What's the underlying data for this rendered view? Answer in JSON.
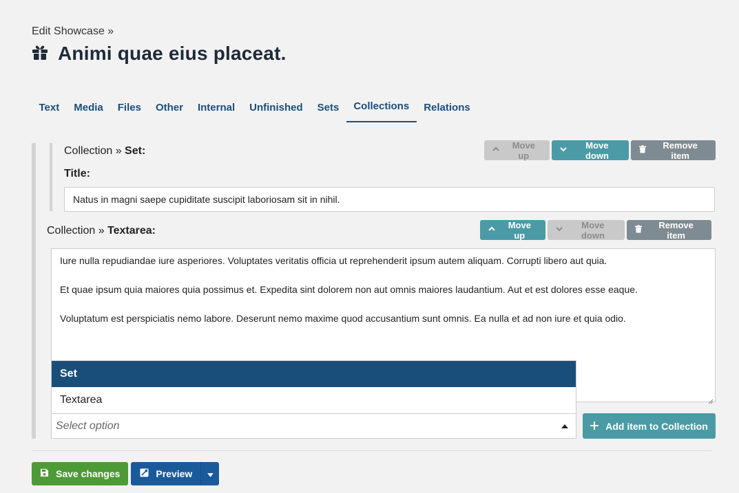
{
  "header": {
    "breadcrumb": "Edit Showcase »",
    "title": "Animi quae eius placeat.",
    "title_icon": "gift-icon"
  },
  "tabs": [
    {
      "label": "Text",
      "active": false
    },
    {
      "label": "Media",
      "active": false
    },
    {
      "label": "Files",
      "active": false
    },
    {
      "label": "Other",
      "active": false
    },
    {
      "label": "Internal",
      "active": false
    },
    {
      "label": "Unfinished",
      "active": false
    },
    {
      "label": "Sets",
      "active": false
    },
    {
      "label": "Collections",
      "active": true
    },
    {
      "label": "Relations",
      "active": false
    }
  ],
  "collection": {
    "items": [
      {
        "prefix": "Collection » ",
        "type": "Set:",
        "field_label": "Title:",
        "field_value": "Natus in magni saepe cupiditate suscipit laboriosam sit in nihil.",
        "move_up": "Move up",
        "move_down": "Move down",
        "remove": "Remove item",
        "move_up_enabled": false,
        "move_down_enabled": true
      },
      {
        "prefix": "Collection » ",
        "type": "Textarea:",
        "paragraphs": [
          "Iure nulla repudiandae iure asperiores. Voluptates veritatis officia ut reprehenderit ipsum autem aliquam. Corrupti libero aut quia.",
          "Et quae ipsum quia maiores quia possimus et. Expedita sint dolorem non aut omnis maiores laudantium. Aut et est dolores esse eaque.",
          "Voluptatum est perspiciatis nemo labore. Deserunt nemo maxime quod accusantium sunt omnis. Ea nulla et ad non iure et quia odio."
        ],
        "move_up": "Move up",
        "move_down": "Move down",
        "remove": "Remove item",
        "move_up_enabled": true,
        "move_down_enabled": false
      }
    ],
    "dropdown_options": [
      "Set",
      "Textarea"
    ],
    "selected_option": "Set",
    "select_placeholder": "Select option",
    "add_button": "Add item to Collection"
  },
  "footer": {
    "save": "Save changes",
    "preview": "Preview"
  },
  "colors": {
    "primary": "#1a4e7a",
    "teal": "#4a9ba5",
    "save_green": "#4e9a36",
    "preview_blue": "#1a5a9a",
    "remove_grey": "#7f8b92"
  }
}
